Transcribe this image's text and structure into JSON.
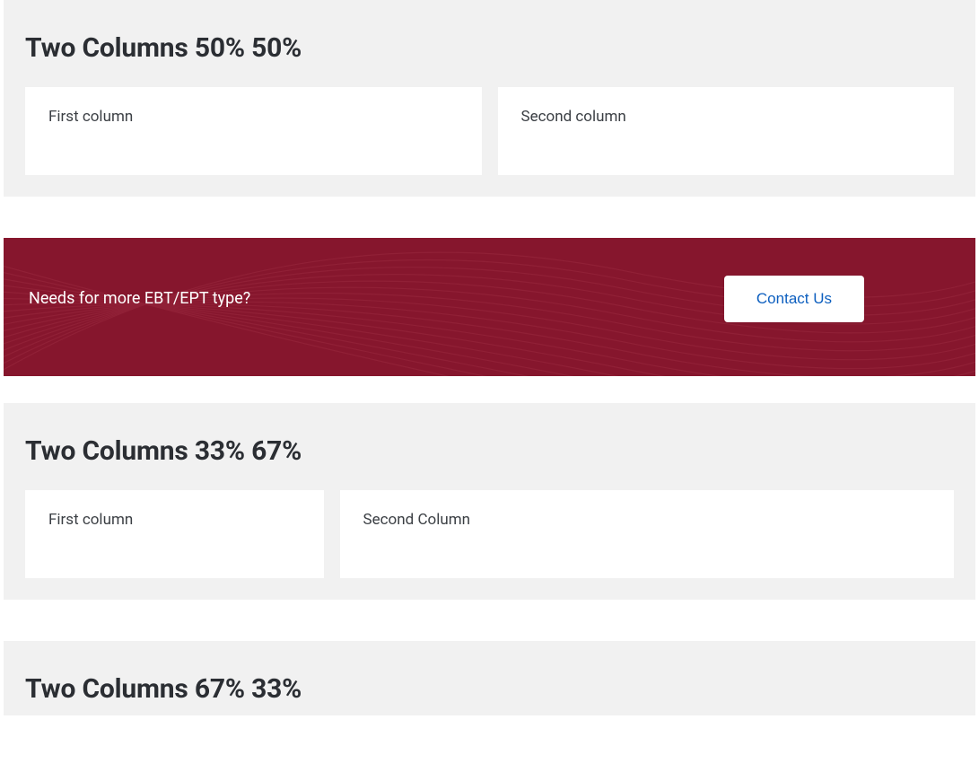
{
  "section1": {
    "title": "Two Columns 50% 50%",
    "col1": "First column",
    "col2": "Second column"
  },
  "cta": {
    "text": "Needs for more EBT/EPT type?",
    "button": "Contact Us"
  },
  "section2": {
    "title": "Two Columns 33% 67%",
    "col1": "First column",
    "col2": "Second Column"
  },
  "section3": {
    "title": "Two Columns 67% 33%"
  },
  "colors": {
    "panel_bg": "#f1f1f1",
    "cta_bg": "#86162d",
    "cta_button_text": "#0d5fbf",
    "heading": "#2b2e33"
  }
}
